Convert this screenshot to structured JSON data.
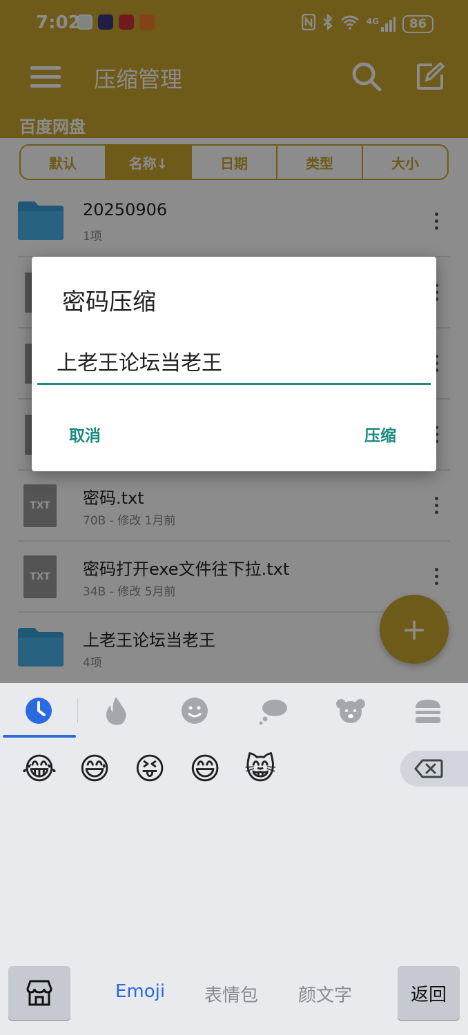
{
  "status_bar": {
    "time": "7:02",
    "battery": "86",
    "network": "4G"
  },
  "app_bar": {
    "title": "压缩管理",
    "location": "百度网盘"
  },
  "sort_tabs": [
    {
      "label": "默认",
      "active": false
    },
    {
      "label": "名称↓",
      "active": true
    },
    {
      "label": "日期",
      "active": false
    },
    {
      "label": "类型",
      "active": false
    },
    {
      "label": "大小",
      "active": false
    }
  ],
  "files": [
    {
      "name": "20250906",
      "meta": "1项",
      "type": "folder"
    },
    {
      "name": "",
      "meta": "",
      "type": "file"
    },
    {
      "name": "",
      "meta": "",
      "type": "file"
    },
    {
      "name": "",
      "meta": "",
      "type": "file"
    },
    {
      "name": "密码.txt",
      "meta": "70B - 修改 1月前",
      "type": "txt"
    },
    {
      "name": "密码打开exe文件往下拉.txt",
      "meta": "34B - 修改 5月前",
      "type": "txt"
    },
    {
      "name": "上老王论坛当老王",
      "meta": "4项",
      "type": "folder"
    }
  ],
  "file_icon_label": "TXT",
  "fab_label": "+",
  "dialog": {
    "title": "密码压缩",
    "input_value": "上老王论坛当老王",
    "cancel_label": "取消",
    "ok_label": "压缩"
  },
  "keyboard": {
    "categories": [
      "recent-icon",
      "fire-icon",
      "smiley-icon",
      "thought-bubble-icon",
      "koala-icon",
      "burger-icon"
    ],
    "emojis": [
      "😂",
      "😅",
      "😝",
      "😄",
      "😸"
    ],
    "tabs": {
      "emoji": "Emoji",
      "stickers": "表情包",
      "kaomoji": "颜文字"
    },
    "back_label": "返回"
  },
  "colors": {
    "accent_gold": "#c9a42e",
    "dialog_teal": "#1a8a80",
    "keyboard_blue": "#2a6ae0"
  }
}
